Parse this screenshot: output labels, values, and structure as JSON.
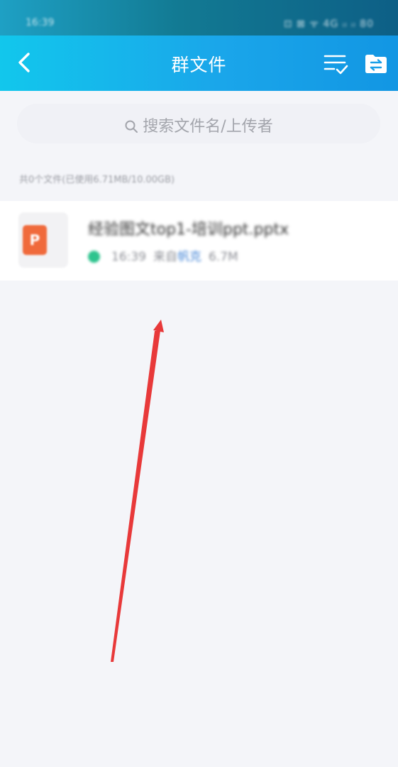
{
  "status_bar": {
    "time": "16:39",
    "indicators": "⊡ ⊠ ᯤ 4G ᵢₗ ᵢₗ 80"
  },
  "header": {
    "title": "群文件",
    "back_icon": "chevron-left-icon",
    "sort_icon": "list-check-icon",
    "transfer_icon": "folder-transfer-icon"
  },
  "search": {
    "placeholder": "搜索文件名/上传者"
  },
  "files": {
    "summary": "共0个文件(已使用6.71MB/10.00GB)",
    "items": [
      {
        "name": "经验图文top1-培训ppt.pptx",
        "icon_letter": "P",
        "time": "16:39",
        "uploader_prefix": "来自",
        "uploader": "帆克",
        "size": "6.7M"
      }
    ]
  },
  "colors": {
    "nav_start": "#12c7ec",
    "nav_end": "#1296e3",
    "ppt_orange": "#f06a3b",
    "arrow_red": "#e8393a"
  }
}
